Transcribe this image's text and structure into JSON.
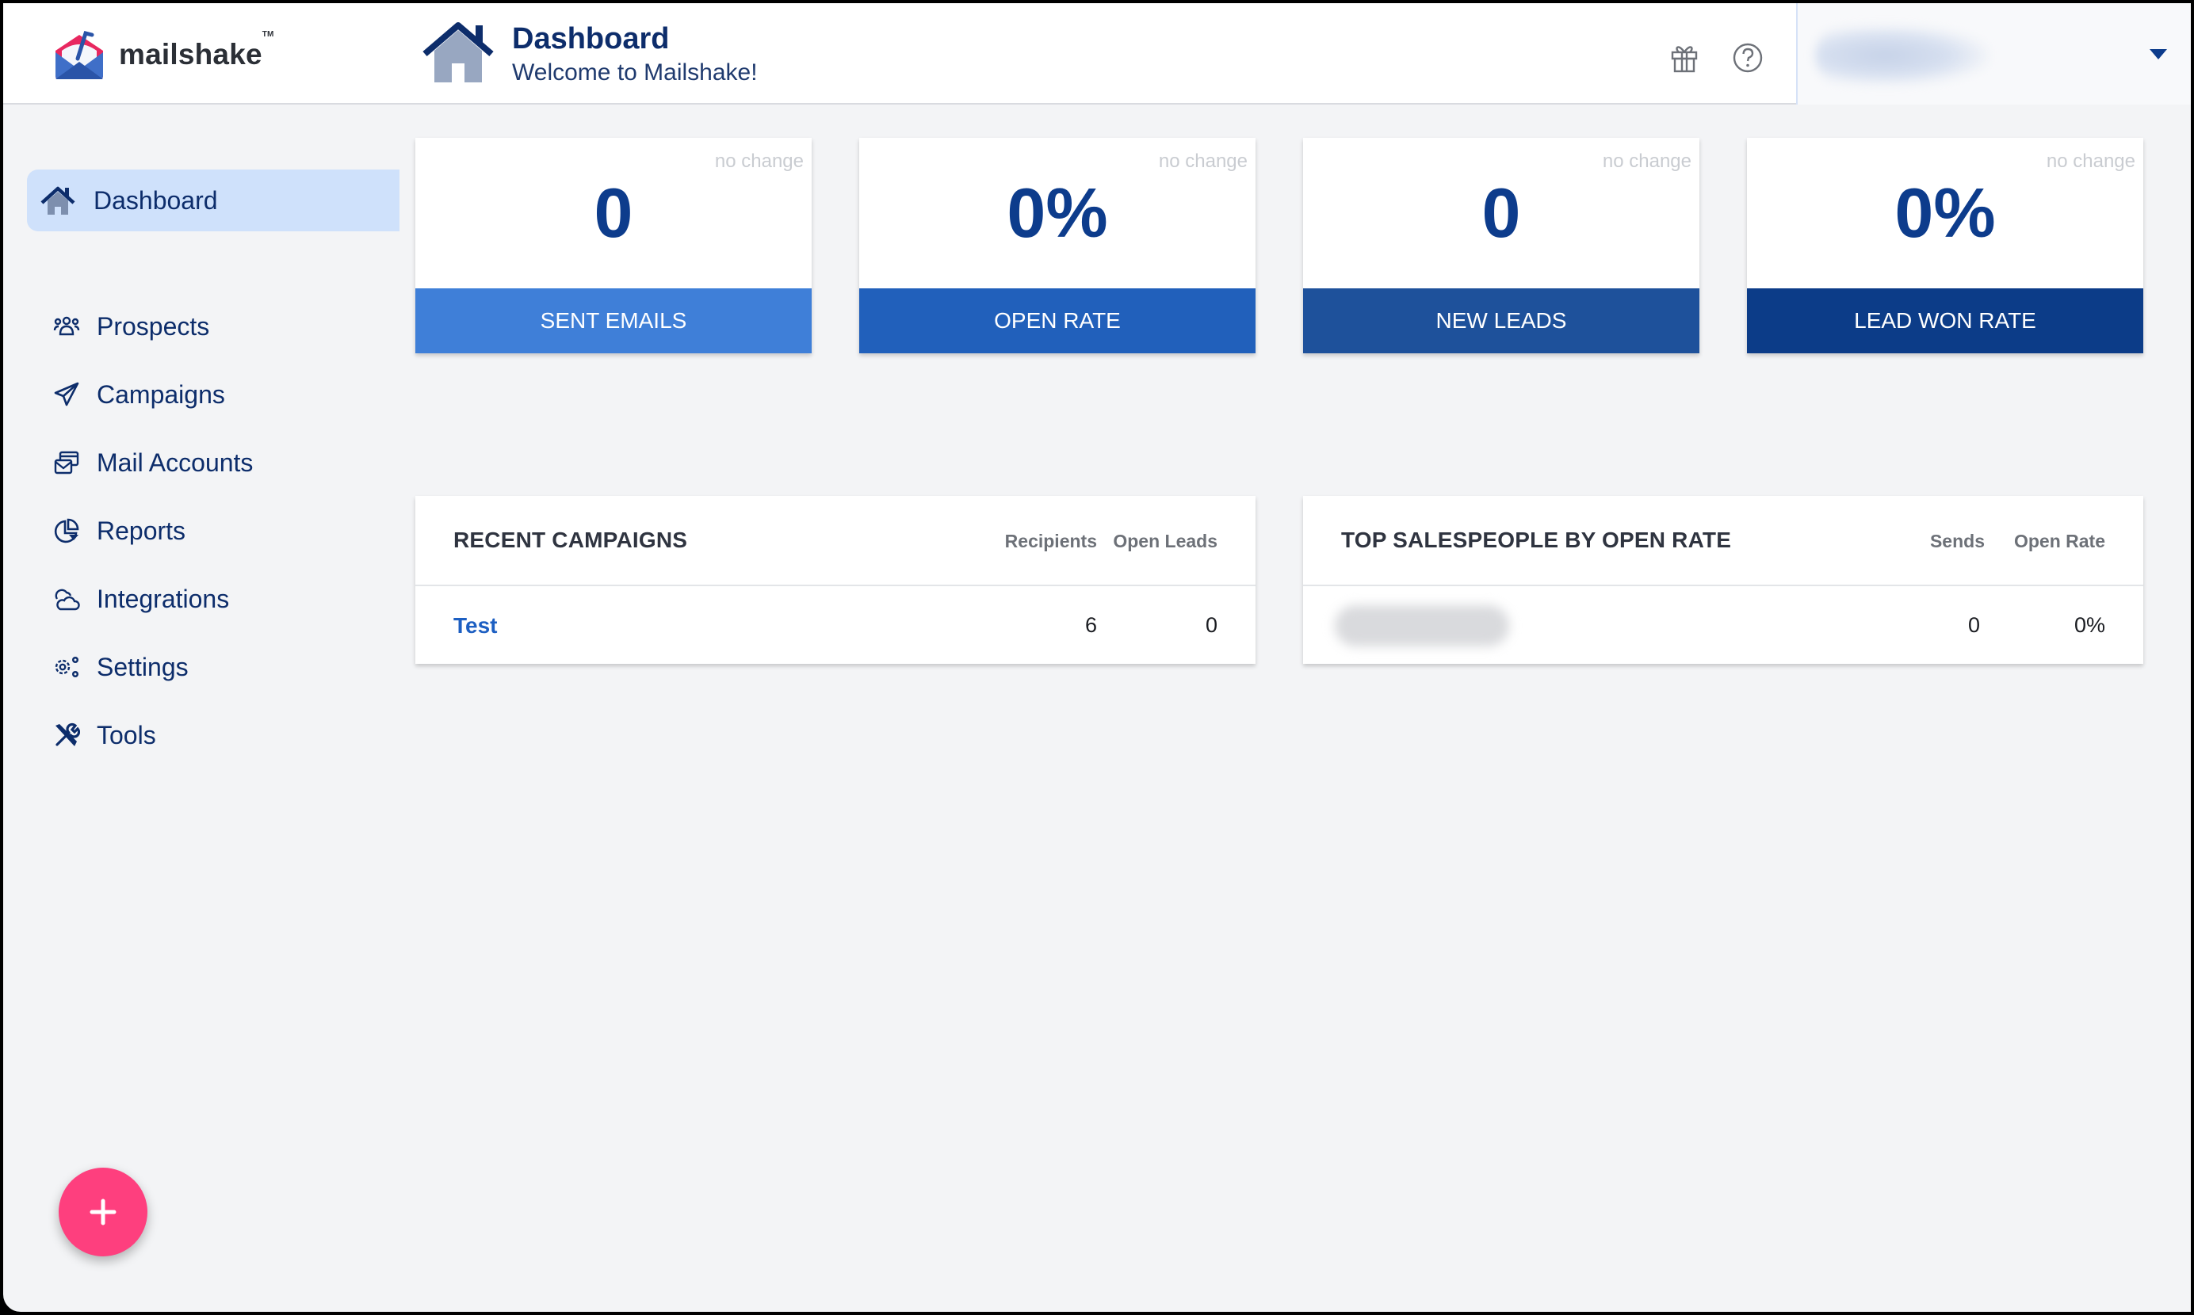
{
  "app": {
    "brand": "mailshake",
    "trademark": "TM"
  },
  "header": {
    "title": "Dashboard",
    "subtitle": "Welcome to Mailshake!",
    "icons": [
      "gift-icon",
      "help-icon"
    ],
    "user_menu": {
      "name": "",
      "caret": "chevron-down-icon"
    }
  },
  "sidebar": {
    "active": {
      "label": "Dashboard",
      "icon": "home-icon"
    },
    "items": [
      {
        "label": "Prospects",
        "icon": "people-icon"
      },
      {
        "label": "Campaigns",
        "icon": "paper-plane-icon"
      },
      {
        "label": "Mail Accounts",
        "icon": "mail-accounts-icon"
      },
      {
        "label": "Reports",
        "icon": "pie-chart-icon"
      },
      {
        "label": "Integrations",
        "icon": "cloud-icon"
      },
      {
        "label": "Settings",
        "icon": "gears-icon"
      },
      {
        "label": "Tools",
        "icon": "tools-icon"
      }
    ]
  },
  "stats": [
    {
      "value": "0",
      "label": "SENT EMAILS",
      "change": "no change",
      "color": "#3f7fd8"
    },
    {
      "value": "0%",
      "label": "OPEN RATE",
      "change": "no change",
      "color": "#2160bb"
    },
    {
      "value": "0",
      "label": "NEW LEADS",
      "change": "no change",
      "color": "#1e519b"
    },
    {
      "value": "0%",
      "label": "LEAD WON RATE",
      "change": "no change",
      "color": "#0c3c88"
    }
  ],
  "recent_campaigns": {
    "title": "RECENT CAMPAIGNS",
    "columns": [
      "Recipients",
      "Open Leads"
    ],
    "rows": [
      {
        "name": "Test",
        "recipients": "6",
        "open_leads": "0"
      }
    ]
  },
  "top_salespeople": {
    "title": "TOP SALESPEOPLE BY OPEN RATE",
    "columns": [
      "Sends",
      "Open Rate"
    ],
    "rows": [
      {
        "name": "",
        "sends": "0",
        "open_rate": "0%"
      }
    ]
  },
  "fab": {
    "icon": "plus-icon",
    "color": "#fe3f7e"
  }
}
